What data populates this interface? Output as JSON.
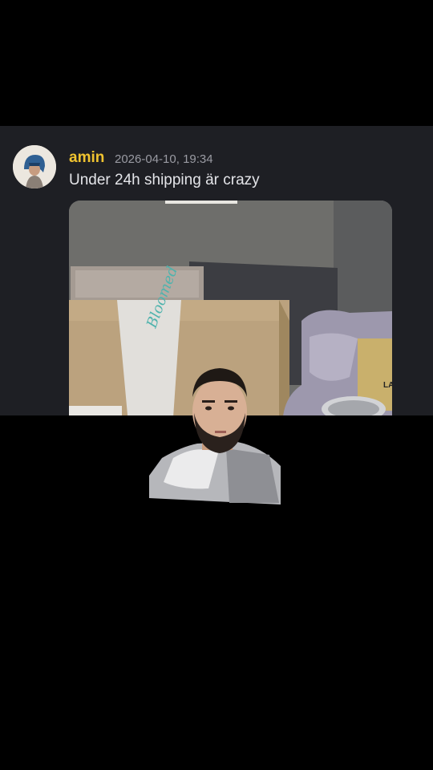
{
  "message": {
    "username": "amin",
    "timestamp": "2026-04-10, 19:34",
    "text": "Under 24h shipping är crazy",
    "username_color": "#f0c330"
  },
  "attachment": {
    "tape_label": "Bloomed",
    "can_label": "LA"
  },
  "icons": {
    "avatar": "user-avatar-photo",
    "overlay": "streamer-facecam"
  },
  "colors": {
    "panel_background": "#1e1f24",
    "page_background": "#000000",
    "message_text": "#e4e5e9",
    "timestamp": "#9a9ba3"
  }
}
